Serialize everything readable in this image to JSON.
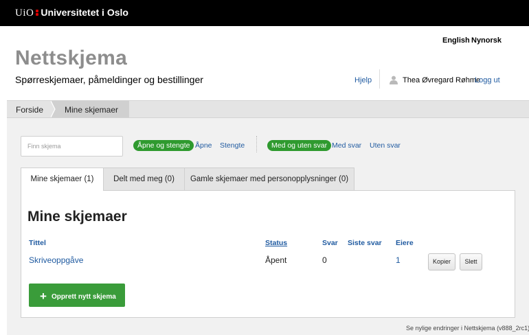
{
  "topbar": {
    "logo_short": "UiO",
    "logo_name": "Universitetet i Oslo",
    "logo_color": "#dd0000"
  },
  "header": {
    "languages": [
      "English",
      "Nynorsk"
    ],
    "title": "Nettskjema",
    "subtitle": "Spørreskjemaer, påmeldinger og bestillinger",
    "help": "Hjelp",
    "user_name": "Thea Øvregard Røhme",
    "logout": "Logg ut"
  },
  "breadcrumb": [
    "Forside",
    "Mine skjemaer"
  ],
  "filters": {
    "search_placeholder": "Finn skjema",
    "status": {
      "active": "Åpne og stengte",
      "options": [
        "Åpne",
        "Stengte"
      ]
    },
    "answers": {
      "active": "Med og uten svar",
      "options": [
        "Med svar",
        "Uten svar"
      ]
    },
    "accent": "#2f9a2f"
  },
  "tabs": [
    "Mine skjemaer (1)",
    "Delt med meg (0)",
    "Gamle skjemaer med personopplysninger (0)"
  ],
  "panel": {
    "title": "Mine skjemaer",
    "columns": [
      "Tittel",
      "Status",
      "Svar",
      "Siste svar",
      "Eiere"
    ],
    "rows": [
      {
        "title": "Skriveoppgåve",
        "status": "Åpent",
        "answers": "0",
        "last_answer": "",
        "owners": "1"
      }
    ],
    "row_actions": [
      "Kopier",
      "Slett"
    ],
    "create_button": "Opprett nytt skjema"
  },
  "footer": "Se nylige endringer i Nettskjema (v888_2rc1)"
}
